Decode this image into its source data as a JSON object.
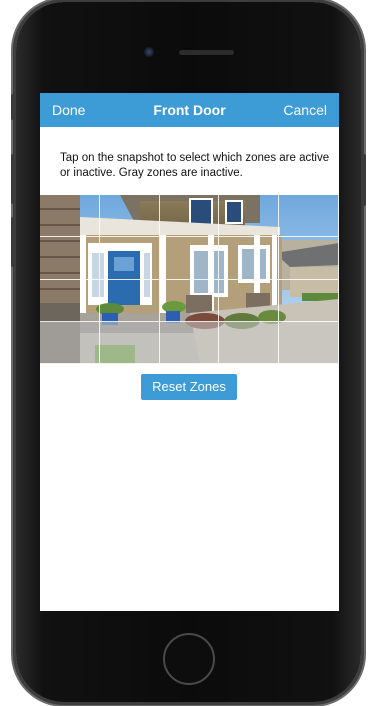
{
  "navbar": {
    "done_label": "Done",
    "title": "Front Door",
    "cancel_label": "Cancel"
  },
  "instructions": "Tap on the snapshot to select which zones are active or inactive. Gray zones are inactive.",
  "snapshot": {
    "zones_grid": {
      "columns": 5,
      "rows": 4,
      "inactive": [
        15,
        16,
        17,
        18,
        19
      ]
    }
  },
  "reset_label": "Reset Zones",
  "colors": {
    "accent": "#3d9bd6"
  }
}
